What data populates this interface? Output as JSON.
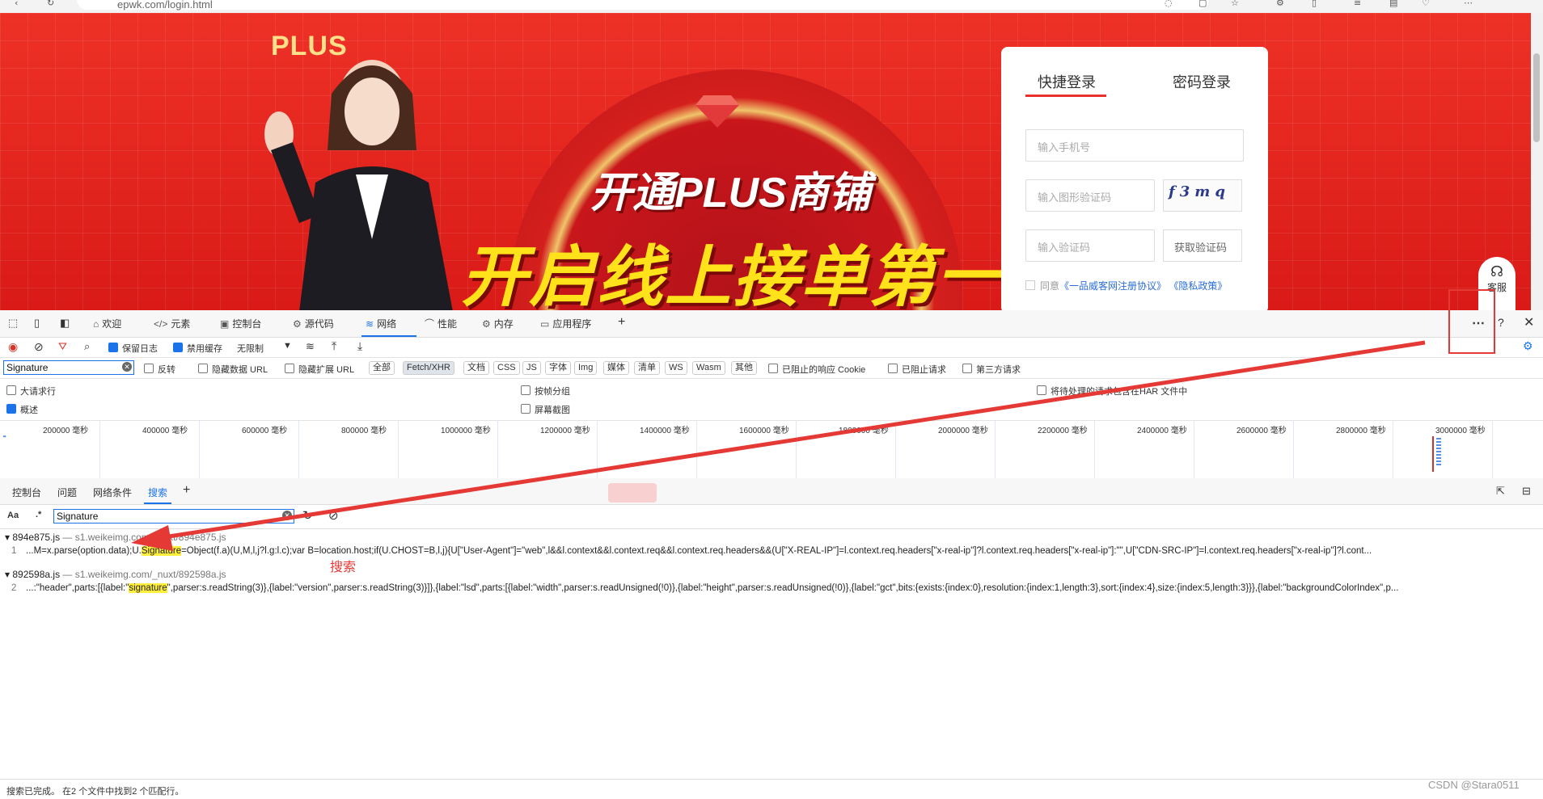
{
  "browser": {
    "url": "epwk.com/login.html"
  },
  "banner": {
    "plus_logo": "PLUS",
    "headline_1": "开通PLUS商铺",
    "headline_2": "开启线上接单第一步"
  },
  "login": {
    "tab_quick": "快捷登录",
    "tab_password": "密码登录",
    "phone_placeholder": "输入手机号",
    "image_captcha_placeholder": "输入图形验证码",
    "captcha_text": "f3mq",
    "sms_code_placeholder": "输入验证码",
    "get_code_label": "获取验证码",
    "agree_prefix": "同意",
    "agree_link_1": "《一品威客网注册协议》",
    "agree_link_2": "《隐私政策》",
    "service_label": "客服"
  },
  "devtools": {
    "tabs": [
      {
        "icon": "⌂",
        "label": "欢迎"
      },
      {
        "icon": "</>",
        "label": "元素"
      },
      {
        "icon": "▣",
        "label": "控制台"
      },
      {
        "icon": "⚙",
        "label": "源代码"
      },
      {
        "icon": "≋",
        "label": "网络"
      },
      {
        "icon": "⌒",
        "label": "性能"
      },
      {
        "icon": "⚙",
        "label": "内存"
      },
      {
        "icon": "▭",
        "label": "应用程序"
      }
    ],
    "toolbar": {
      "preserve_log": "保留日志",
      "disable_cache": "禁用缓存",
      "throttle": "无限制"
    },
    "filter": {
      "value": "Signature",
      "invert": "反转",
      "hide_data_urls": "隐藏数据 URL",
      "hide_extension_urls": "隐藏扩展 URL",
      "types": [
        "全部",
        "Fetch/XHR",
        "文档",
        "CSS",
        "JS",
        "字体",
        "Img",
        "媒体",
        "清单",
        "WS",
        "Wasm",
        "其他"
      ],
      "selected_type": "Fetch/XHR",
      "blocked_cookies": "已阻止的响应 Cookie",
      "blocked_requests": "已阻止请求",
      "third_party": "第三方请求"
    },
    "options": {
      "big_rows": "大请求行",
      "group_by_frame": "按帧分组",
      "har_sensitive": "将待处理的请求包含在HAR 文件中",
      "overview": "概述",
      "screenshots": "屏幕截图"
    },
    "timeline": {
      "unit": "毫秒",
      "ticks": [
        "200000",
        "400000",
        "600000",
        "800000",
        "1000000",
        "1200000",
        "1400000",
        "1600000",
        "1800000",
        "2000000",
        "2200000",
        "2400000",
        "2600000",
        "2800000",
        "3000000",
        "3"
      ]
    },
    "drawer_tabs": [
      "控制台",
      "问题",
      "网络条件",
      "搜索"
    ],
    "search": {
      "aa_label": "Aa",
      "regex_label": ".*",
      "query": "Signature"
    },
    "results": [
      {
        "file": "894e875.js",
        "url": "— s1.weikeimg.com/_nuxt/894e875.js",
        "line": "1",
        "before": "...M=x.parse(option.data);U.",
        "match": "Signature",
        "after": "=Object(f.a)(U,M,l,j?l.g:l.c);var B=location.host;if(U.CHOST=B,l,j){U[\"User-Agent\"]=\"web\",l&&l.context&&l.context.req&&l.context.req.headers&&(U[\"X-REAL-IP\"]=l.context.req.headers[\"x-real-ip\"]?l.context.req.headers[\"x-real-ip\"]:\"\",U[\"CDN-SRC-IP\"]=l.context.req.headers[\"x-real-ip\"]?l.cont..."
      },
      {
        "file": "892598a.js",
        "url": "— s1.weikeimg.com/_nuxt/892598a.js",
        "line": "2",
        "before": "...:\"header\",parts:[{label:\"",
        "match": "signature",
        "after": "\",parser:s.readString(3)},{label:\"version\",parser:s.readString(3)}]},{label:\"lsd\",parts:[{label:\"width\",parser:s.readUnsigned(!0)},{label:\"height\",parser:s.readUnsigned(!0)},{label:\"gct\",bits:{exists:{index:0},resolution:{index:1,length:3},sort:{index:4},size:{index:5,length:3}}},{label:\"backgroundColorIndex\",p..."
      }
    ],
    "status": "搜索已完成。 在2 个文件中找到2 个匹配行。"
  },
  "annotation": {
    "label": "搜索",
    "color": "#e53935"
  },
  "watermark": "CSDN @Stara0511",
  "colors": {
    "accent": "#1a73e8",
    "brand_red": "#e82a23",
    "highlight": "#ffee3b"
  }
}
